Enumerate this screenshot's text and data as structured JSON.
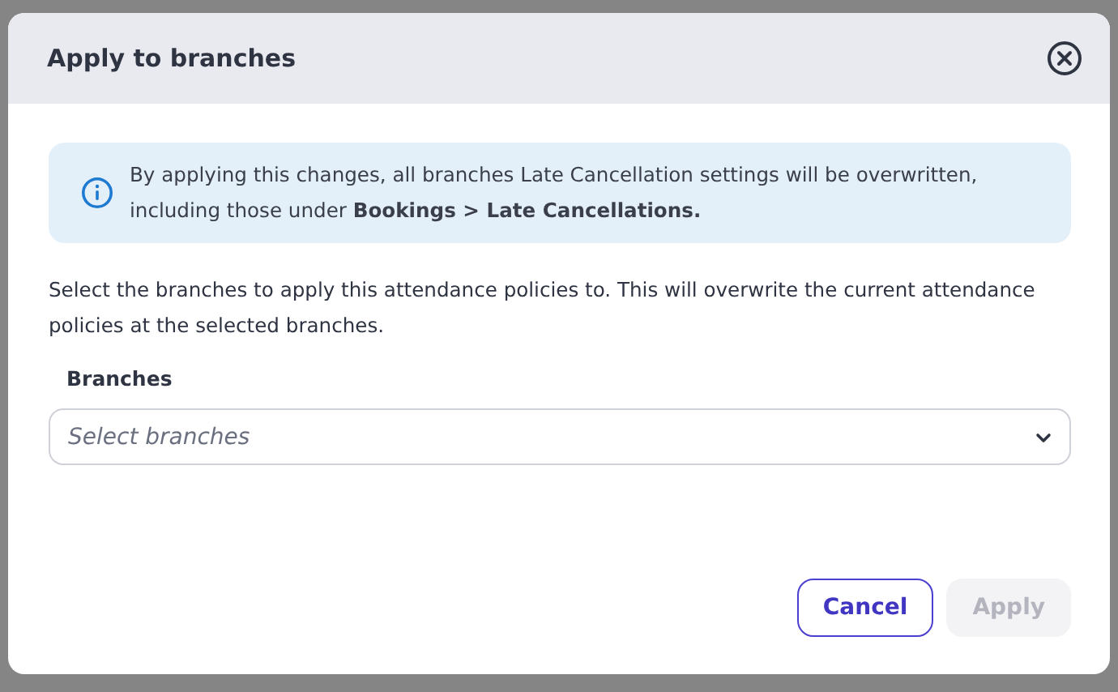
{
  "dialog": {
    "title": "Apply to branches",
    "notice": "By applying this changes, all branches Late Cancellation settings will be overwritten, including those under **Bookings > Late Cancellations.**",
    "description": "Select the branches to apply this attendance policies to. This will overwrite the current attendance policies at the selected branches.",
    "field": {
      "label": "Branches",
      "placeholder": "Select branches"
    },
    "buttons": [
      {
        "label": "Cancel",
        "kind": "secondary",
        "disabled": false
      },
      {
        "label": "Apply",
        "kind": "primary",
        "disabled": true
      }
    ]
  }
}
